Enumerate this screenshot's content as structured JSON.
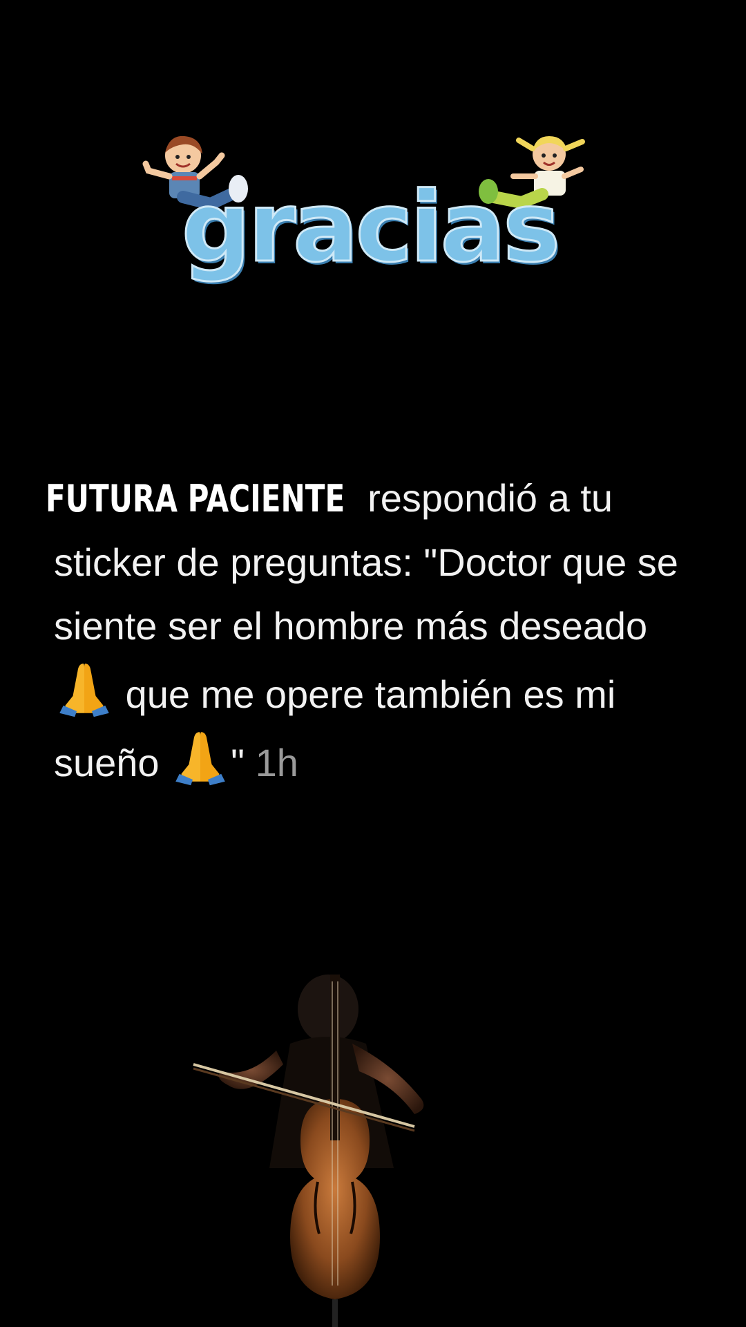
{
  "sticker": {
    "text": "gracias",
    "icon": "gracias-kids-sticker"
  },
  "reply": {
    "username": "FUTURA PACIENTE",
    "action": "respondió a tu sticker de preguntas:",
    "message_part1": "\"Doctor que se siente ser el hombre más deseado",
    "message_part2": "que me opere también es mi sueño",
    "message_end": "\"",
    "emoji_icon": "folded-hands-emoji",
    "time": "1h"
  },
  "background_media": {
    "icon": "cellist-photo"
  },
  "colors": {
    "background": "#000000",
    "text": "#f2f2f2",
    "time": "#9a9a9a",
    "sticker_blue": "#7dc2e8"
  }
}
